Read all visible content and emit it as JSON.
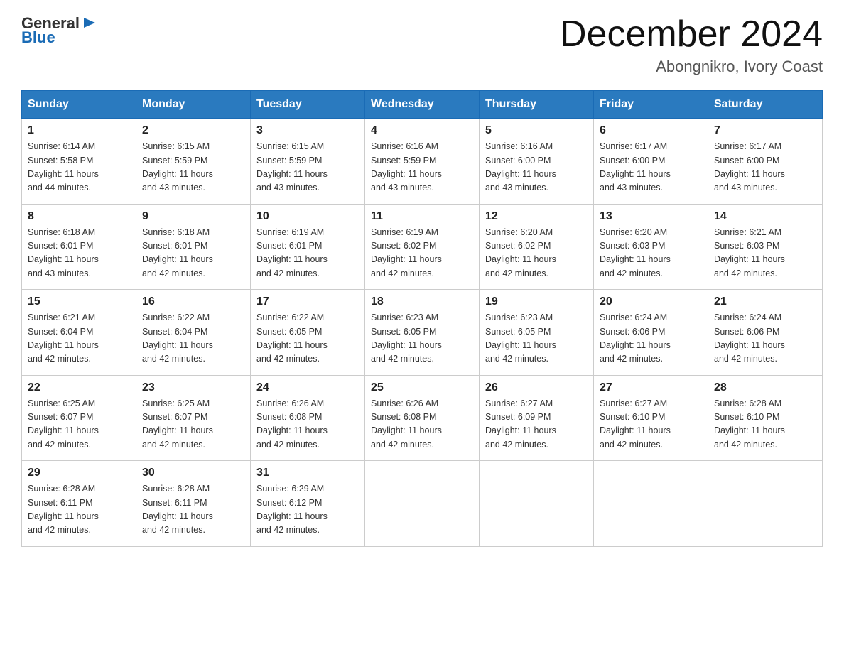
{
  "logo": {
    "general": "General",
    "blue": "Blue"
  },
  "header": {
    "month": "December 2024",
    "location": "Abongnikro, Ivory Coast"
  },
  "weekdays": [
    "Sunday",
    "Monday",
    "Tuesday",
    "Wednesday",
    "Thursday",
    "Friday",
    "Saturday"
  ],
  "weeks": [
    [
      {
        "day": "1",
        "sunrise": "6:14 AM",
        "sunset": "5:58 PM",
        "daylight": "11 hours and 44 minutes."
      },
      {
        "day": "2",
        "sunrise": "6:15 AM",
        "sunset": "5:59 PM",
        "daylight": "11 hours and 43 minutes."
      },
      {
        "day": "3",
        "sunrise": "6:15 AM",
        "sunset": "5:59 PM",
        "daylight": "11 hours and 43 minutes."
      },
      {
        "day": "4",
        "sunrise": "6:16 AM",
        "sunset": "5:59 PM",
        "daylight": "11 hours and 43 minutes."
      },
      {
        "day": "5",
        "sunrise": "6:16 AM",
        "sunset": "6:00 PM",
        "daylight": "11 hours and 43 minutes."
      },
      {
        "day": "6",
        "sunrise": "6:17 AM",
        "sunset": "6:00 PM",
        "daylight": "11 hours and 43 minutes."
      },
      {
        "day": "7",
        "sunrise": "6:17 AM",
        "sunset": "6:00 PM",
        "daylight": "11 hours and 43 minutes."
      }
    ],
    [
      {
        "day": "8",
        "sunrise": "6:18 AM",
        "sunset": "6:01 PM",
        "daylight": "11 hours and 43 minutes."
      },
      {
        "day": "9",
        "sunrise": "6:18 AM",
        "sunset": "6:01 PM",
        "daylight": "11 hours and 42 minutes."
      },
      {
        "day": "10",
        "sunrise": "6:19 AM",
        "sunset": "6:01 PM",
        "daylight": "11 hours and 42 minutes."
      },
      {
        "day": "11",
        "sunrise": "6:19 AM",
        "sunset": "6:02 PM",
        "daylight": "11 hours and 42 minutes."
      },
      {
        "day": "12",
        "sunrise": "6:20 AM",
        "sunset": "6:02 PM",
        "daylight": "11 hours and 42 minutes."
      },
      {
        "day": "13",
        "sunrise": "6:20 AM",
        "sunset": "6:03 PM",
        "daylight": "11 hours and 42 minutes."
      },
      {
        "day": "14",
        "sunrise": "6:21 AM",
        "sunset": "6:03 PM",
        "daylight": "11 hours and 42 minutes."
      }
    ],
    [
      {
        "day": "15",
        "sunrise": "6:21 AM",
        "sunset": "6:04 PM",
        "daylight": "11 hours and 42 minutes."
      },
      {
        "day": "16",
        "sunrise": "6:22 AM",
        "sunset": "6:04 PM",
        "daylight": "11 hours and 42 minutes."
      },
      {
        "day": "17",
        "sunrise": "6:22 AM",
        "sunset": "6:05 PM",
        "daylight": "11 hours and 42 minutes."
      },
      {
        "day": "18",
        "sunrise": "6:23 AM",
        "sunset": "6:05 PM",
        "daylight": "11 hours and 42 minutes."
      },
      {
        "day": "19",
        "sunrise": "6:23 AM",
        "sunset": "6:05 PM",
        "daylight": "11 hours and 42 minutes."
      },
      {
        "day": "20",
        "sunrise": "6:24 AM",
        "sunset": "6:06 PM",
        "daylight": "11 hours and 42 minutes."
      },
      {
        "day": "21",
        "sunrise": "6:24 AM",
        "sunset": "6:06 PM",
        "daylight": "11 hours and 42 minutes."
      }
    ],
    [
      {
        "day": "22",
        "sunrise": "6:25 AM",
        "sunset": "6:07 PM",
        "daylight": "11 hours and 42 minutes."
      },
      {
        "day": "23",
        "sunrise": "6:25 AM",
        "sunset": "6:07 PM",
        "daylight": "11 hours and 42 minutes."
      },
      {
        "day": "24",
        "sunrise": "6:26 AM",
        "sunset": "6:08 PM",
        "daylight": "11 hours and 42 minutes."
      },
      {
        "day": "25",
        "sunrise": "6:26 AM",
        "sunset": "6:08 PM",
        "daylight": "11 hours and 42 minutes."
      },
      {
        "day": "26",
        "sunrise": "6:27 AM",
        "sunset": "6:09 PM",
        "daylight": "11 hours and 42 minutes."
      },
      {
        "day": "27",
        "sunrise": "6:27 AM",
        "sunset": "6:10 PM",
        "daylight": "11 hours and 42 minutes."
      },
      {
        "day": "28",
        "sunrise": "6:28 AM",
        "sunset": "6:10 PM",
        "daylight": "11 hours and 42 minutes."
      }
    ],
    [
      {
        "day": "29",
        "sunrise": "6:28 AM",
        "sunset": "6:11 PM",
        "daylight": "11 hours and 42 minutes."
      },
      {
        "day": "30",
        "sunrise": "6:28 AM",
        "sunset": "6:11 PM",
        "daylight": "11 hours and 42 minutes."
      },
      {
        "day": "31",
        "sunrise": "6:29 AM",
        "sunset": "6:12 PM",
        "daylight": "11 hours and 42 minutes."
      },
      null,
      null,
      null,
      null
    ]
  ],
  "labels": {
    "sunrise": "Sunrise:",
    "sunset": "Sunset:",
    "daylight": "Daylight:"
  }
}
